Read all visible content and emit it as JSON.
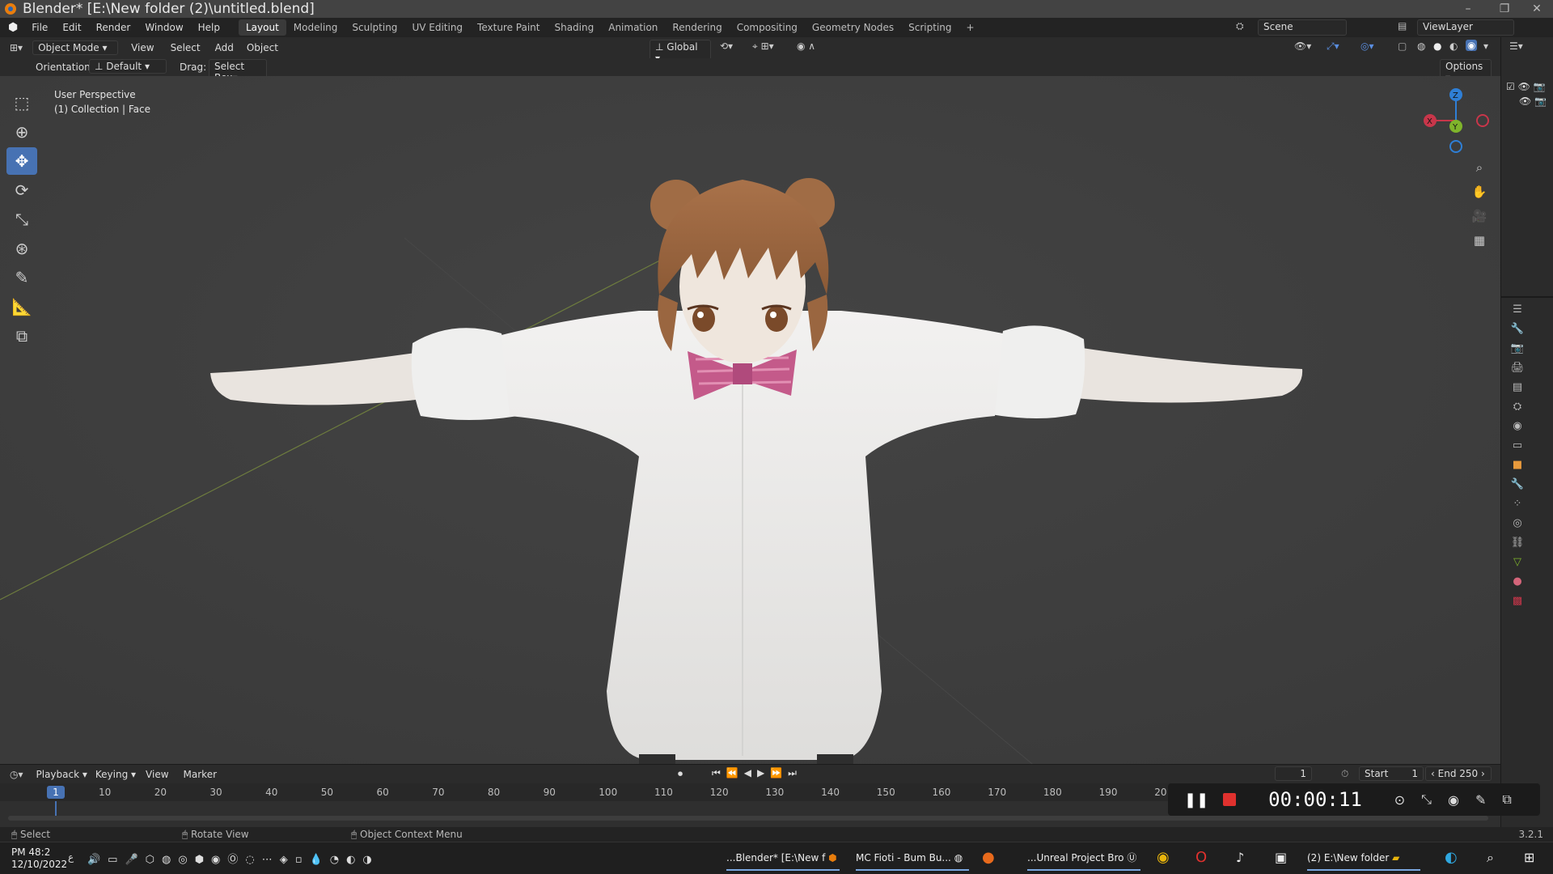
{
  "window": {
    "title": "Blender* [E:\\New folder (2)\\untitled.blend]"
  },
  "menu": {
    "items": [
      "File",
      "Edit",
      "Render",
      "Window",
      "Help"
    ],
    "workspaces": [
      "Layout",
      "Modeling",
      "Sculpting",
      "UV Editing",
      "Texture Paint",
      "Shading",
      "Animation",
      "Rendering",
      "Compositing",
      "Geometry Nodes",
      "Scripting"
    ],
    "add_tab": "+",
    "scene": "Scene",
    "view_layer": "ViewLayer"
  },
  "header": {
    "mode": "Object Mode",
    "menus": [
      "View",
      "Select",
      "Add",
      "Object"
    ],
    "transform": "Global",
    "orientation_label": "Orientation:",
    "orientation_value": "Default",
    "drag_label": "Drag:",
    "drag_value": "Select Box",
    "options": "Options"
  },
  "viewport": {
    "perspective": "User Perspective",
    "collection": "(1) Collection | Face",
    "gizmo": {
      "x": "X",
      "y": "Y",
      "z": "Z"
    }
  },
  "timeline": {
    "menus": [
      "Playback",
      "Keying",
      "View",
      "Marker"
    ],
    "current_frame": "1",
    "frame_field": "1",
    "ticks": [
      "10",
      "20",
      "30",
      "40",
      "50",
      "60",
      "70",
      "80",
      "90",
      "100",
      "110",
      "120",
      "130",
      "140",
      "150",
      "160",
      "170",
      "180",
      "190",
      "20"
    ],
    "start_label": "Start",
    "start_value": "1",
    "end_label": "End",
    "end_value": "250"
  },
  "recorder": {
    "time": "00:00:11"
  },
  "status": {
    "select": "Select",
    "rotate": "Rotate View",
    "context": "Object Context Menu",
    "version": "3.2.1"
  },
  "taskbar": {
    "clock_time": "PM 48:2",
    "clock_date": "12/10/2022",
    "lang": "ع",
    "apps": [
      {
        "label": "...Blender* [E:\\New f"
      },
      {
        "label": "MC Fioti - Bum Bu..."
      },
      {
        "label": "...Unreal Project Bro"
      },
      {
        "label": "(2) E:\\New folder"
      }
    ]
  },
  "colors": {
    "accent": "#4772b3",
    "record": "#e0312e",
    "axis_x": "#c8364a",
    "axis_y": "#7fb42b",
    "axis_z": "#2f7fd6"
  }
}
